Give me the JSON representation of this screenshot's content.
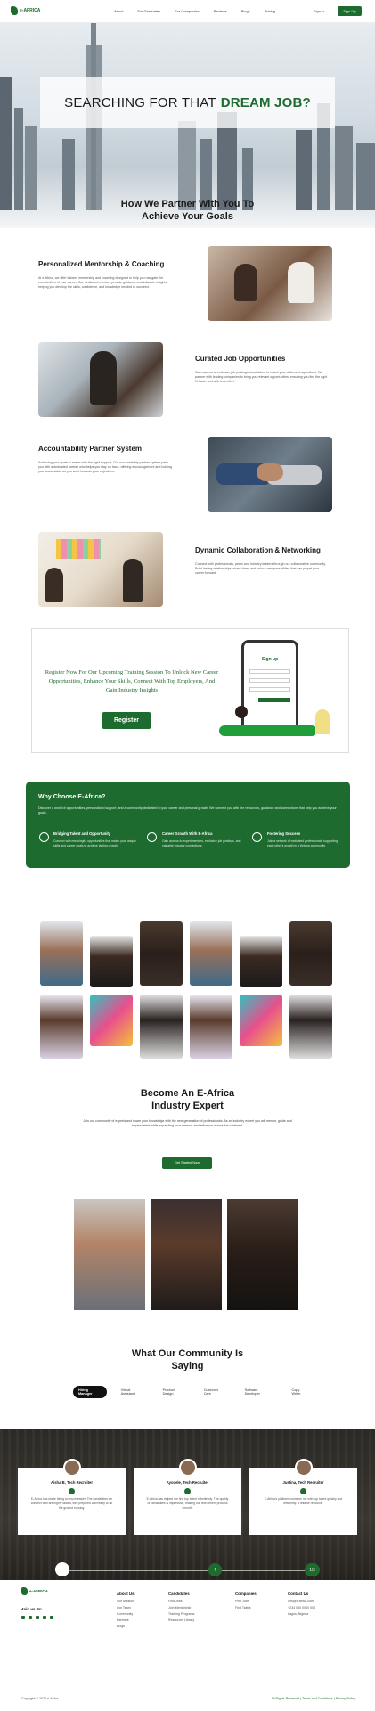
{
  "nav": {
    "logo_text": "e-AFRICA",
    "links": [
      "About",
      "For Graduates",
      "For Companies",
      "Reviews",
      "Blogs",
      "Pricing"
    ],
    "sign_in": "Sign In",
    "sign_up": "Sign Up"
  },
  "hero": {
    "title_lead": "SEARCHING FOR THAT",
    "title_accent": "DREAM JOB?",
    "partner_heading_line1": "How We Partner With You To",
    "partner_heading_line2": "Achieve Your Goals"
  },
  "features": [
    {
      "title": "Personalized Mentorship & Coaching",
      "text": "At e-Africa, we offer tailored mentorship and coaching designed to help you navigate the complexities of your career. Our dedicated mentors provide guidance and valuable insights, helping you develop the skills, confidence, and knowledge needed to succeed."
    },
    {
      "title": "Curated Job Opportunities",
      "text": "Gain access to exclusive job postings handpicked to match your skills and aspirations. We partner with leading companies to bring you relevant opportunities, ensuring you find the right fit faster and with less effort."
    },
    {
      "title": "Accountability Partner System",
      "text": "Achieving your goals is easier with the right support. Our accountability partner system pairs you with a dedicated partner who helps you stay on track, offering encouragement and holding you accountable as you work towards your objectives."
    },
    {
      "title": "Dynamic Collaboration & Networking",
      "text": "Connect with professionals, peers and industry leaders through our collaborative community. Build lasting relationships, share ideas and unlock new possibilities that can propel your career forward."
    }
  ],
  "register": {
    "text": "Register Now For Our Upcoming Training Session To Unlock New Career Opportunities, Enhance Your Skills, Connect With Top Employers, And Gain Industry Insights",
    "button": "Register",
    "phone_title": "Sign up"
  },
  "why": {
    "title": "Why Choose E-Africa?",
    "intro": "Discover a world of opportunities, personalized support, and a community dedicated to your career and personal growth. We connect you with the resources, guidance and connections that help you achieve your goals.",
    "items": [
      {
        "title": "Bridging Talent and Opportunity",
        "text": "Connect with meaningful opportunities that match your unique skills and career goals to achieve lasting growth."
      },
      {
        "title": "Career Growth With E-Africa",
        "text": "Gain access to expert mentors, exclusive job postings, and valuable industry connections."
      },
      {
        "title": "Fostering Success",
        "text": "Join a network of motivated professionals supporting each other's growth in a thriving community."
      }
    ]
  },
  "expert": {
    "title_line1": "Become An E-Africa",
    "title_line2": "Industry Expert",
    "text": "Join our community of experts and share your knowledge with the next generation of professionals. As an industry expert you will mentor, guide and inspire talent while expanding your network and influence across the continent.",
    "button": "Get Started Now"
  },
  "community": {
    "title_line1": "What Our Community Is",
    "title_line2": "Saying",
    "tabs": [
      "Hiring Manager",
      "Virtual Assistant",
      "Product Design",
      "Customer Care",
      "Software Developer",
      "Copy Writer"
    ],
    "active_tab": "Hiring Manager"
  },
  "testimonials": [
    {
      "name": "Aisha B, Tech Recruiter",
      "text": "E-Africa has made hiring so much easier. The candidates we connect with are highly skilled, well prepared and ready to hit the ground running."
    },
    {
      "name": "Ayodele, Tech Recruiter",
      "text": "E-Africa has helped me find top talent effortlessly. The quality of candidates is impressive, making our recruitment process smooth."
    },
    {
      "name": "Justina, Tech Recruiter",
      "text": "E-Africa's platform connects me with top talent quickly and efficiently. A reliable resource."
    }
  ],
  "slider": {
    "counter": "1/3"
  },
  "footer": {
    "logo_text": "e-AFRICA",
    "join_us": "Join us On",
    "columns": [
      {
        "heading": "About Us",
        "items": [
          "Our Mission",
          "Our Team",
          "Community",
          "Partners",
          "Blogs"
        ]
      },
      {
        "heading": "Candidates",
        "items": [
          "Find Jobs",
          "Join Mentorship",
          "Training Programs",
          "Resources Library"
        ]
      },
      {
        "heading": "Companies",
        "items": [
          "Post Jobs",
          "Find Talent"
        ]
      },
      {
        "heading": "Contact Us",
        "items": [
          "info@e-africa.com",
          "+234 000 0000 000",
          "Lagos, Nigeria"
        ]
      }
    ],
    "copyright": "Copyright © 2024 e-Africa",
    "legal": "All Rights Reserved | Terms and Conditions | Privacy Policy"
  },
  "colors": {
    "brand_green": "#1e6b2f",
    "dark_bg": "#2c2a26"
  }
}
